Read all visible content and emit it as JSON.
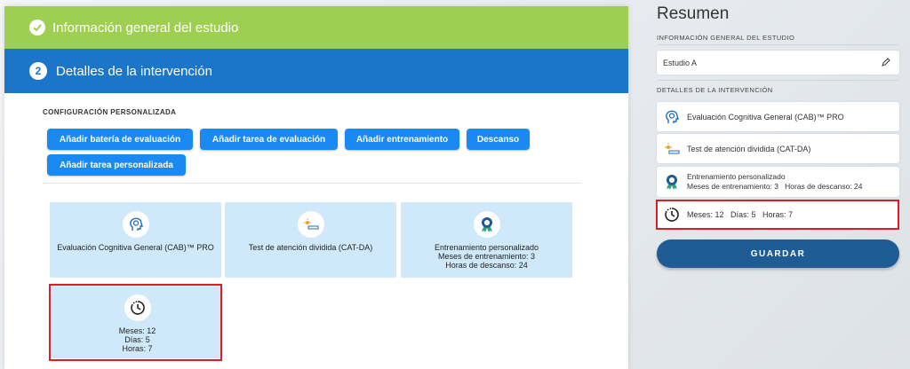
{
  "steps": {
    "step1_label": "Información general del estudio",
    "step2_number": "2",
    "step2_label": "Detalles de la intervención"
  },
  "config": {
    "section_label": "CONFIGURACIÓN PERSONALIZADA",
    "buttons": [
      "Añadir batería de evaluación",
      "Añadir tarea de evaluación",
      "Añadir entrenamiento",
      "Descanso",
      "Añadir tarea personalizada"
    ]
  },
  "cards": {
    "cab_title": "Evaluación Cognitiva General (CAB)™ PRO",
    "catda_title": "Test de atención dividida (CAT-DA)",
    "training_title": "Entrenamiento personalizado",
    "training_months": "Meses de entrenamiento: 3",
    "training_rest": "Horas de descanso: 24",
    "rest_months": "Meses: 12",
    "rest_days": "Días: 5",
    "rest_hours": "Horas: 7"
  },
  "summary": {
    "title": "Resumen",
    "general_label": "INFORMACIÓN GENERAL DEL ESTUDIO",
    "study_name": "Estudio A",
    "details_label": "DETALLES DE LA INTERVENCIÓN",
    "cab": "Evaluación Cognitiva General (CAB)™ PRO",
    "catda": "Test de atención dividida (CAT-DA)",
    "training_title": "Entrenamiento personalizado",
    "training_detail": "Meses de entrenamiento: 3   Horas de descanso: 24",
    "rest_detail": "Meses: 12   Días: 5   Horas: 7",
    "save_label": "GUARDAR"
  },
  "colors": {
    "green_step": "#9ecf53",
    "blue_step": "#1b75c9",
    "button_blue": "#1a8af2",
    "card_bg": "#cfe9fb",
    "highlight_red": "#d61f26",
    "save_button": "#1f5c96"
  },
  "icons": {
    "step1": "check-icon",
    "cab": "head-brain-icon",
    "catda": "attention-task-icon",
    "training": "head-badge-icon",
    "rest": "clock-icon",
    "edit": "pencil-icon"
  }
}
